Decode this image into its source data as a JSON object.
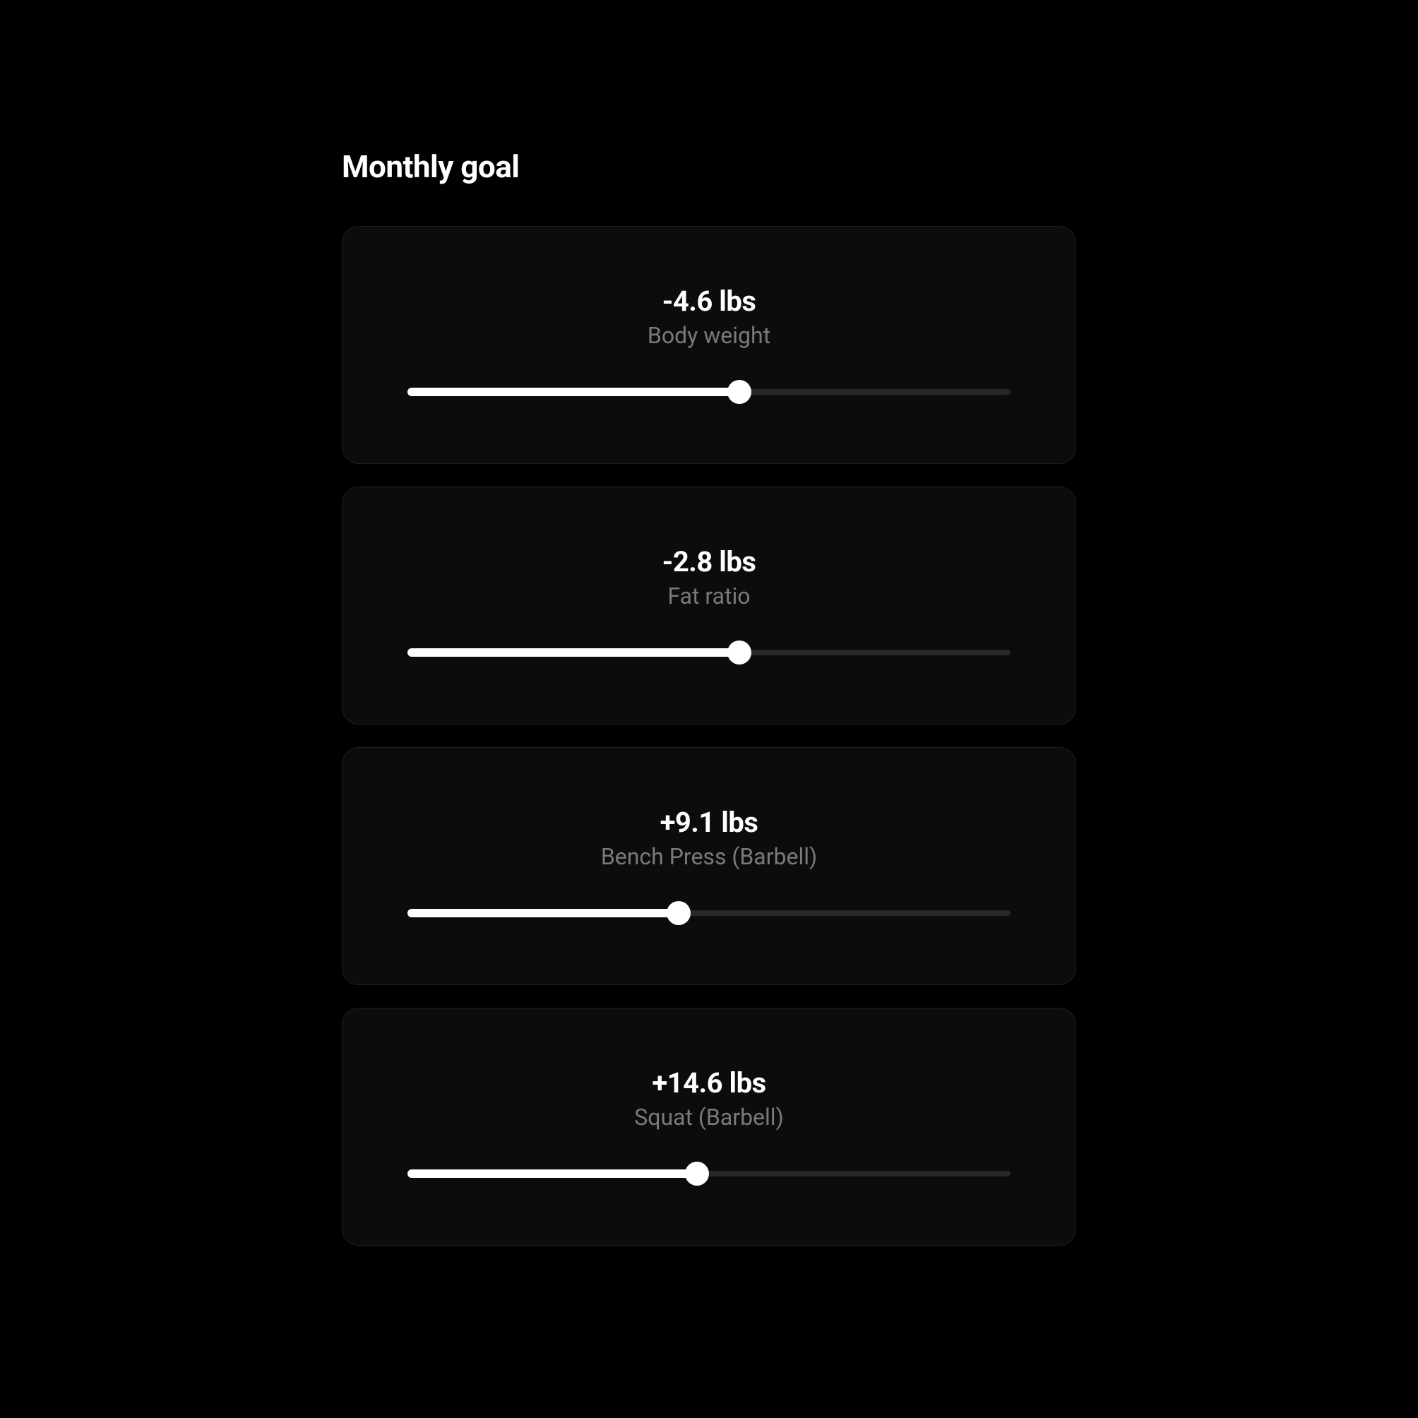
{
  "title": "Monthly goal",
  "goals": [
    {
      "value": "-4.6 lbs",
      "label": "Body weight",
      "progress": 55
    },
    {
      "value": "-2.8 lbs",
      "label": "Fat ratio",
      "progress": 55
    },
    {
      "value": "+9.1 lbs",
      "label": "Bench Press (Barbell)",
      "progress": 45
    },
    {
      "value": "+14.6 lbs",
      "label": "Squat (Barbell)",
      "progress": 48
    }
  ]
}
